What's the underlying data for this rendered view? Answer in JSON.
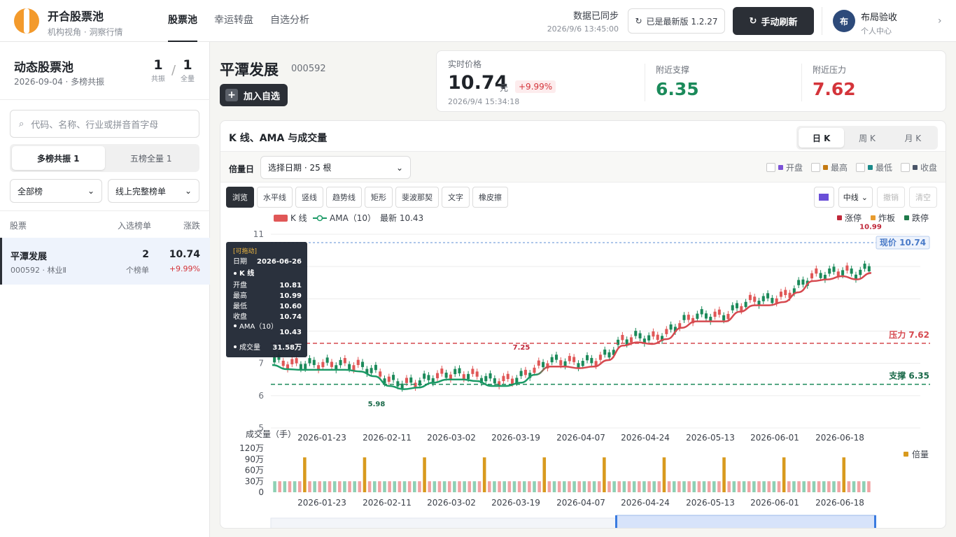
{
  "header": {
    "brand_title": "开合股票池",
    "brand_subtitle": "机构视角 · 洞察行情",
    "nav": [
      {
        "label": "股票池",
        "active": true
      },
      {
        "label": "幸运转盘",
        "active": false
      },
      {
        "label": "自选分析",
        "active": false
      }
    ],
    "sync_status": "数据已同步",
    "sync_time": "2026/9/6 13:45:00",
    "version_label": "已是最新版 1.2.27",
    "refresh_label": "手动刷新",
    "avatar_text": "布",
    "user_name": "布局验收",
    "user_role": "个人中心"
  },
  "sidebar": {
    "title": "动态股票池",
    "subtitle": "2026-09-04 · 多榜共振",
    "resonance_count": "1",
    "resonance_label": "共振",
    "total_count": "1",
    "total_label": "全量",
    "search_placeholder": "代码、名称、行业或拼音首字母",
    "segments": [
      {
        "label": "多榜共振  1",
        "active": true
      },
      {
        "label": "五榜全量  1",
        "active": false
      }
    ],
    "filter_board": "全部榜",
    "filter_list": "线上完整榜单",
    "table_headers": {
      "stock": "股票",
      "lists": "入选榜单",
      "change": "涨跌"
    },
    "rows": [
      {
        "name": "平潭发展",
        "code_industry": "000592 · 林业Ⅱ",
        "list_count": "2",
        "list_count_label": "个榜单",
        "price": "10.74",
        "change": "+9.99%"
      }
    ]
  },
  "stock": {
    "name": "平潭发展",
    "code": "000592",
    "add_label": "加入自选",
    "price_label": "实时价格",
    "price": "10.74",
    "unit": "元",
    "change": "+9.99%",
    "time": "2026/9/4 15:34:18",
    "support_label": "附近支撑",
    "support": "6.35",
    "pressure_label": "附近压力",
    "pressure": "7.62"
  },
  "chart_panel": {
    "title": "K 线、AMA 与成交量",
    "period_tabs": [
      {
        "label": "日 K",
        "active": true
      },
      {
        "label": "周 K",
        "active": false
      },
      {
        "label": "月 K",
        "active": false
      }
    ],
    "volume_day_label": "倍量日",
    "volume_day_select": "选择日期 · 25 根",
    "toggles": [
      {
        "label": "开盘",
        "color": "#7b52d6"
      },
      {
        "label": "最高",
        "color": "#c47a12"
      },
      {
        "label": "最低",
        "color": "#1a8a8a"
      },
      {
        "label": "收盘",
        "color": "#4a5568"
      }
    ],
    "tools": [
      {
        "label": "浏览",
        "active": true
      },
      {
        "label": "水平线",
        "active": false
      },
      {
        "label": "竖线",
        "active": false
      },
      {
        "label": "趋势线",
        "active": false
      },
      {
        "label": "矩形",
        "active": false
      },
      {
        "label": "斐波那契",
        "active": false
      },
      {
        "label": "文字",
        "active": false
      },
      {
        "label": "橡皮擦",
        "active": false
      }
    ],
    "line_style": "中线",
    "undo_label": "撤销",
    "clear_label": "清空",
    "draw_color": "#6a4fd8"
  },
  "chart_data": {
    "type": "candlestick",
    "legend": {
      "kline": "K 线",
      "ama": "AMA（10）",
      "latest": "最新 10.43"
    },
    "limit_legend": [
      {
        "label": "涨停",
        "color": "#c0283a"
      },
      {
        "label": "炸板",
        "color": "#e89b2e"
      },
      {
        "label": "跌停",
        "color": "#1e7a4a"
      }
    ],
    "y_ticks": [
      "11",
      "7",
      "6",
      "5"
    ],
    "ylim": [
      5,
      11
    ],
    "x_ticks": [
      "2026-01-23",
      "2026-02-11",
      "2026-03-02",
      "2026-03-19",
      "2026-04-07",
      "2026-04-24",
      "2026-05-13",
      "2026-06-01",
      "2026-06-18"
    ],
    "current_price_label": "现价  10.74",
    "current_price": 10.74,
    "pressure_label": "压力  7.62",
    "pressure": 7.62,
    "support_label": "支撑  6.35",
    "support": 6.35,
    "annotations": [
      {
        "text": "5.98",
        "value": 5.98
      },
      {
        "text": "7.25",
        "value": 7.25
      },
      {
        "text": "10.99",
        "value": 10.99
      }
    ],
    "ama_points": [
      6.95,
      6.82,
      6.8,
      6.8,
      6.8,
      6.8,
      6.75,
      6.6,
      6.3,
      6.2,
      6.25,
      6.4,
      6.5,
      6.5,
      6.45,
      6.3,
      6.3,
      6.4,
      6.65,
      6.9,
      6.9,
      6.85,
      6.9,
      7.1,
      7.55,
      7.65,
      7.6,
      7.75,
      8.1,
      8.3,
      8.3,
      8.3,
      8.6,
      8.8,
      8.8,
      8.9,
      9.2,
      9.55,
      9.6,
      9.7,
      9.6,
      9.8
    ],
    "volume": {
      "title": "成交量（手）",
      "y_ticks": [
        "120万",
        "90万",
        "60万",
        "30万",
        "0"
      ],
      "ylim": [
        0,
        1200000
      ],
      "double_volume_label": "倍量",
      "bar_count": 120,
      "normal_level": 300000,
      "double_level": 950000,
      "double_indices": [
        6,
        18,
        30,
        42,
        54,
        66,
        78,
        90,
        102,
        114
      ]
    },
    "tooltip": {
      "badge": "[可拖动]",
      "date_label": "日期",
      "date": "2026-06-26",
      "series": "K 线",
      "open_label": "开盘",
      "open": "10.81",
      "high_label": "最高",
      "high": "10.99",
      "low_label": "最低",
      "low": "10.60",
      "close_label": "收盘",
      "close": "10.74",
      "ama_label": "AMA（10）",
      "ama": "10.43",
      "vol_label": "成交量",
      "vol": "31.58万"
    }
  }
}
